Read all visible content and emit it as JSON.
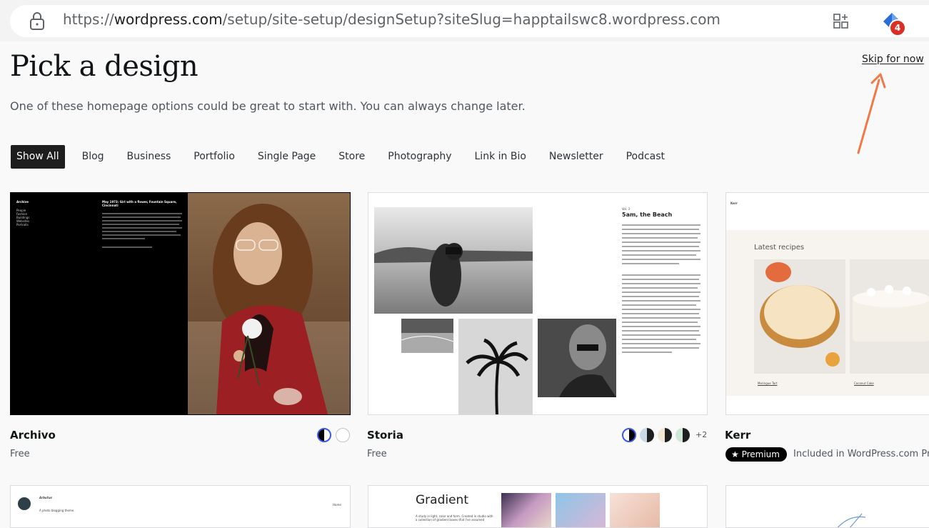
{
  "browser": {
    "url_prefix": "https://",
    "url_domain": "wordpress.com",
    "url_path": "/setup/site-setup/designSetup?siteSlug=happtailswc8.wordpress.com",
    "badge_count": "4"
  },
  "header": {
    "title": "Pick a design",
    "subtitle": "One of these homepage options could be great to start with. You can always change later.",
    "skip": "Skip for now"
  },
  "categories": [
    "Show All",
    "Blog",
    "Business",
    "Portfolio",
    "Single Page",
    "Store",
    "Photography",
    "Link in Bio",
    "Newsletter",
    "Podcast"
  ],
  "designs": [
    {
      "name": "Archivo",
      "price": "Free",
      "preview": {
        "nav_title": "Archive",
        "nav_items": [
          "People",
          "Fashion",
          "Buildings",
          "Websites",
          "Portraits"
        ],
        "headline": "May 1973: Girl with a flower, Fountain Square, Cincinnati"
      }
    },
    {
      "name": "Storia",
      "price": "Free",
      "more_styles": "+2",
      "preview": {
        "kicker": "Vol. 3",
        "headline": "5am, the Beach"
      }
    },
    {
      "name": "Kerr",
      "badge": "★ Premium",
      "included": "Included in WordPress.com Pr",
      "preview": {
        "brand": "Kerr",
        "section": "Latest recipes",
        "items": [
          "Meringue Tart",
          "Coconut Cake"
        ]
      }
    }
  ],
  "row2": [
    {
      "name": "Arbutus",
      "tagline": "A photo blogging theme.",
      "nav": "Home"
    },
    {
      "name": "Gradient",
      "desc": "A study in light, color and form. Created in studio with a collection of gradient boxes that I've assumed"
    }
  ]
}
